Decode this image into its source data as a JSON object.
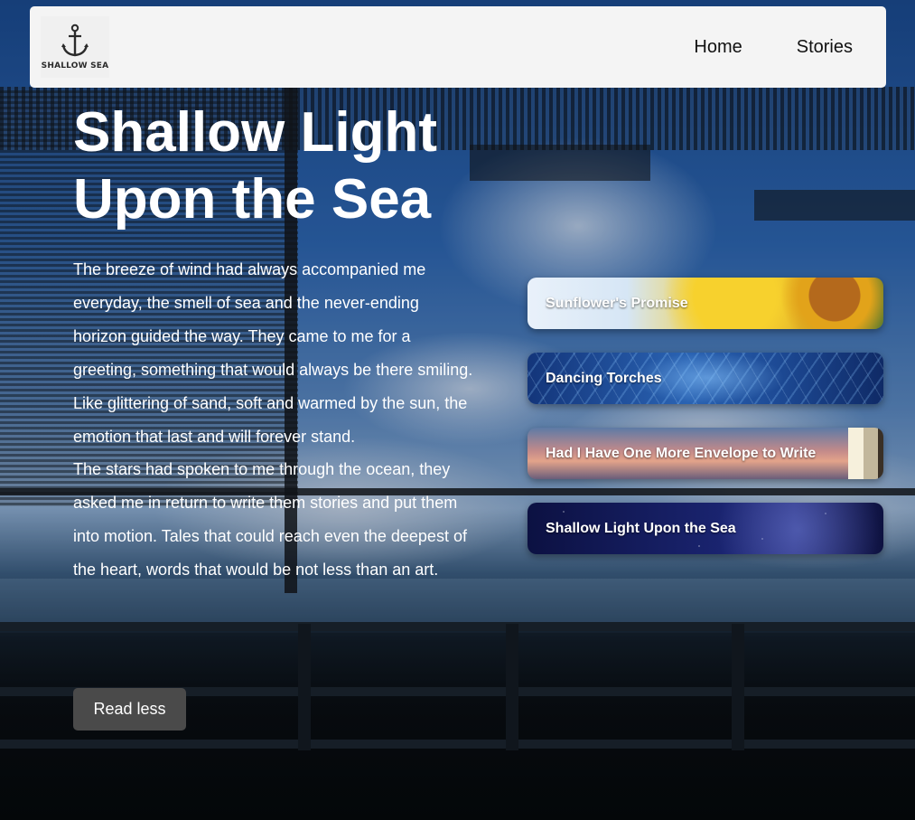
{
  "nav": {
    "logo_text": "SHALLOW SEA",
    "links": [
      {
        "label": "Home"
      },
      {
        "label": "Stories"
      }
    ]
  },
  "main": {
    "title": "Shallow Light Upon the Sea",
    "paragraphs": [
      "The breeze of wind had always accompanied me everyday, the smell of sea and the never-ending horizon guided the way. They came to me for a greeting, something that would always be there smiling. Like glittering of sand, soft and warmed by the sun, the emotion that last and will forever stand.",
      "The stars had spoken to me through the ocean, they asked me in return to write them stories and put them into motion. Tales that could reach even the deepest of the heart, words that would be not less than an art."
    ],
    "read_button": "Read less"
  },
  "stories": [
    {
      "label": "Sunflower's Promise"
    },
    {
      "label": "Dancing Torches"
    },
    {
      "label": "Had I Have One More Envelope to Write"
    },
    {
      "label": "Shallow Light Upon the Sea"
    }
  ],
  "icons": {
    "logo": "anchor-icon"
  },
  "colors": {
    "navbar_bg": "#f4f4f4",
    "button_bg": "#4a4a4a",
    "text_light": "#ffffff"
  }
}
